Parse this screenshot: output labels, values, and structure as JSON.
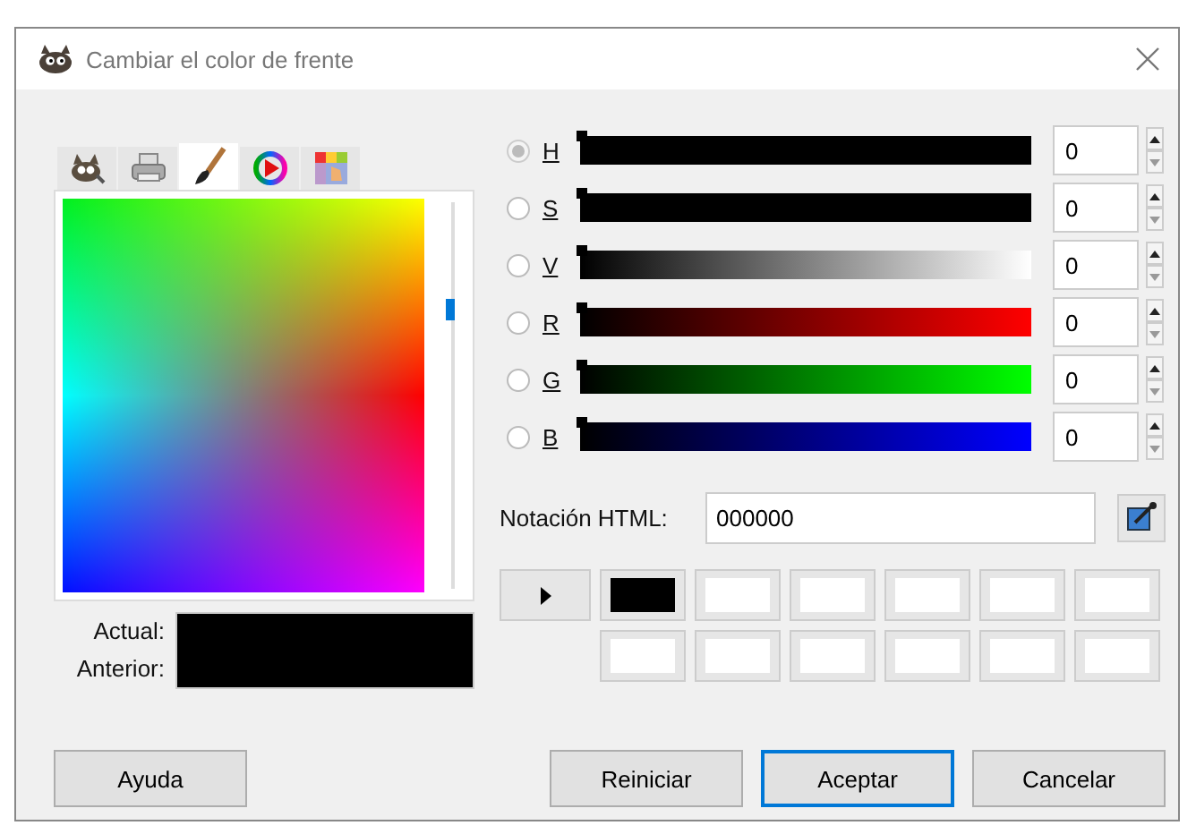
{
  "window": {
    "title": "Cambiar el color de frente"
  },
  "tabs": [
    {
      "kind": "mascot",
      "selected": false
    },
    {
      "kind": "printer",
      "selected": false
    },
    {
      "kind": "brush",
      "selected": true
    },
    {
      "kind": "wheel",
      "selected": false
    },
    {
      "kind": "palette",
      "selected": false
    }
  ],
  "hue_slider": {
    "level": 0.28
  },
  "channels": [
    {
      "label": "H",
      "selected": true,
      "disabled": true,
      "color": "#000000",
      "level": 0,
      "value": "0"
    },
    {
      "label": "S",
      "selected": false,
      "disabled": false,
      "color": "#000000",
      "level": 0,
      "value": "0"
    },
    {
      "label": "V",
      "selected": false,
      "disabled": false,
      "color": "#ffffff",
      "level": 0,
      "value": "0"
    },
    {
      "label": "R",
      "selected": false,
      "disabled": false,
      "color": "#ff0000",
      "level": 0,
      "value": "0"
    },
    {
      "label": "G",
      "selected": false,
      "disabled": false,
      "color": "#00ff00",
      "level": 0,
      "value": "0"
    },
    {
      "label": "B",
      "selected": false,
      "disabled": false,
      "color": "#0000ff",
      "level": 0,
      "value": "0"
    }
  ],
  "html_notation": {
    "label": "Notación HTML:",
    "value": "000000"
  },
  "history": [
    {
      "color": "#000000"
    },
    {
      "color": "#ffffff"
    },
    {
      "color": "#ffffff"
    },
    {
      "color": "#ffffff"
    },
    {
      "color": "#ffffff"
    },
    {
      "color": "#ffffff"
    },
    {
      "color": "#ffffff"
    },
    {
      "color": "#ffffff"
    },
    {
      "color": "#ffffff"
    },
    {
      "color": "#ffffff"
    },
    {
      "color": "#ffffff"
    },
    {
      "color": "#ffffff"
    }
  ],
  "preview": {
    "current": {
      "label": "Actual:",
      "color": "#000000"
    },
    "previous": {
      "label": "Anterior:",
      "color": "#000000"
    }
  },
  "buttons": [
    {
      "label": "Ayuda",
      "kind": "help",
      "focused": false
    },
    {
      "label": "Reiniciar",
      "kind": "action",
      "focused": false
    },
    {
      "label": "Aceptar",
      "kind": "action",
      "focused": true
    },
    {
      "label": "Cancelar",
      "kind": "action",
      "focused": false
    }
  ]
}
